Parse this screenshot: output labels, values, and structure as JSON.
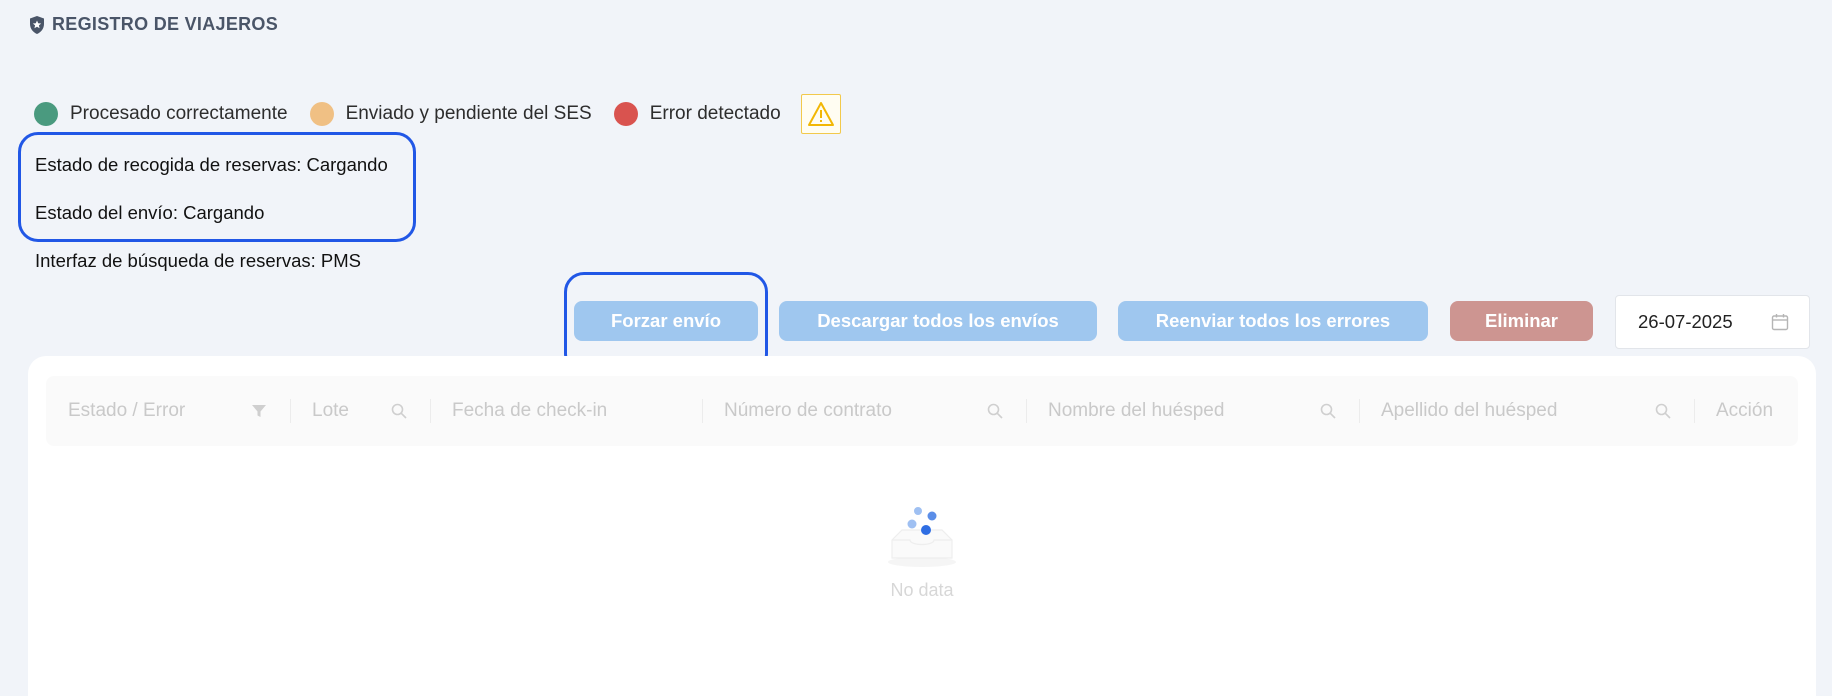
{
  "header": {
    "title": "REGISTRO DE VIAJEROS",
    "icon": "shield-star-icon"
  },
  "legend": {
    "items": [
      {
        "label": "Procesado correctamente",
        "color": "#4a9a7f"
      },
      {
        "label": "Enviado y pendiente del SES",
        "color": "#f0c084"
      },
      {
        "label": "Error detectado",
        "color": "#d9534f"
      }
    ],
    "warning_icon": "warning-icon"
  },
  "status": {
    "collection": "Estado de recogida de reservas: Cargando",
    "send": "Estado del envío: Cargando",
    "interface": "Interfaz de búsqueda de reservas: PMS"
  },
  "toolbar": {
    "force_send": "Forzar envío",
    "download_all": "Descargar todos los envíos",
    "resend_errors": "Reenviar todos los errores",
    "delete": "Eliminar",
    "date_value": "26-07-2025"
  },
  "table": {
    "columns": [
      {
        "label": "Estado / Error",
        "icon": "filter-icon"
      },
      {
        "label": "Lote",
        "icon": "search-icon"
      },
      {
        "label": "Fecha de check-in",
        "icon": ""
      },
      {
        "label": "Número de contrato",
        "icon": "search-icon"
      },
      {
        "label": "Nombre del huésped",
        "icon": "search-icon"
      },
      {
        "label": "Apellido del huésped",
        "icon": "search-icon"
      },
      {
        "label": "Acción",
        "icon": ""
      }
    ],
    "empty_text": "No data"
  }
}
